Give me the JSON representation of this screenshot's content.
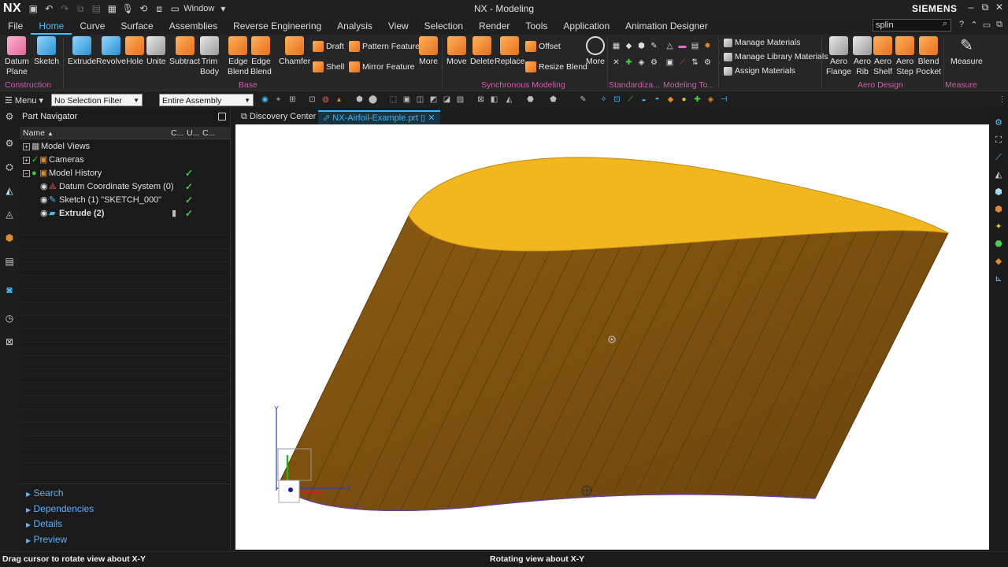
{
  "app": {
    "logo": "NX",
    "title": "NX - Modeling",
    "brand": "SIEMENS",
    "window_menu": "Window"
  },
  "tabs": [
    {
      "label": "File"
    },
    {
      "label": "Home"
    },
    {
      "label": "Curve"
    },
    {
      "label": "Surface"
    },
    {
      "label": "Assemblies"
    },
    {
      "label": "Reverse Engineering"
    },
    {
      "label": "Analysis"
    },
    {
      "label": "View"
    },
    {
      "label": "Selection"
    },
    {
      "label": "Render"
    },
    {
      "label": "Tools"
    },
    {
      "label": "Application"
    },
    {
      "label": "Animation Designer"
    }
  ],
  "active_tab": "Home",
  "command_search": {
    "value": "splin"
  },
  "ribbon": {
    "construction": {
      "datum_plane": "Datum\nPlane",
      "sketch": "Sketch",
      "group": "Construction"
    },
    "base": {
      "extrude": "Extrude",
      "revolve": "Revolve",
      "hole": "Hole",
      "unite": "Unite",
      "subtract": "Subtract",
      "trim_body": "Trim\nBody",
      "edge_blend": "Edge\nBlend",
      "edge_blend2": "Edge\nBlend",
      "chamfer": "Chamfer",
      "draft": "Draft",
      "shell": "Shell",
      "pattern_feature": "Pattern Feature",
      "mirror_feature": "Mirror Feature",
      "more": "More",
      "group": "Base"
    },
    "sync": {
      "move": "Move",
      "delete": "Delete",
      "replace": "Replace",
      "offset": "Offset",
      "resize_blend": "Resize Blend",
      "more": "More",
      "group": "Synchronous Modeling"
    },
    "standardize_group": "Standardiza...",
    "modeling_tools_group": "Modeling To...",
    "materials": {
      "manage": "Manage Materials",
      "library": "Manage Library Materials",
      "assign": "Assign Materials"
    },
    "aero": {
      "flange": "Aero\nFlange",
      "rib": "Aero\nRib",
      "shelf": "Aero\nShelf",
      "step": "Aero\nStep",
      "blend_pocket": "Blend\nPocket",
      "group": "Aero Design"
    },
    "measure": {
      "label": "Measure",
      "group": "Measure"
    }
  },
  "selection_bar": {
    "menu": "Menu",
    "filter": "No Selection Filter",
    "scope": "Entire Assembly"
  },
  "navigator": {
    "title": "Part Navigator",
    "columns": {
      "name": "Name",
      "c1": "C...",
      "c2": "U...",
      "c3": "C..."
    },
    "rows": [
      {
        "label": "Model Views"
      },
      {
        "label": "Cameras"
      },
      {
        "label": "Model History"
      },
      {
        "label": "Datum Coordinate System (0)"
      },
      {
        "label": "Sketch (1) \"SKETCH_000\""
      },
      {
        "label": "Extrude (2)"
      }
    ],
    "sections": [
      "Search",
      "Dependencies",
      "Details",
      "Preview"
    ]
  },
  "doc_tabs": {
    "discovery": "Discovery Center",
    "part": "NX-Airfoil-Example.prt"
  },
  "triad": {
    "y": "Y",
    "x": "X"
  },
  "status": {
    "left": "Drag cursor to rotate view about X-Y",
    "center": "Rotating view about X-Y"
  },
  "colors": {
    "accent": "#3fc1ff",
    "body_side": "#7a4f0e",
    "top_face": "#f2b61f"
  }
}
